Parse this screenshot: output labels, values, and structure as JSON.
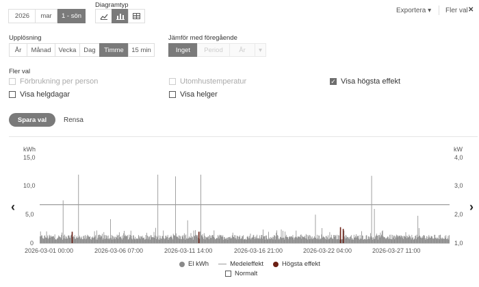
{
  "date": {
    "year": "2026",
    "month": "mar",
    "range": "1 - sön"
  },
  "chart_type": {
    "label": "Diagramtyp",
    "icons": [
      "line-chart-icon",
      "bar-chart-icon",
      "table-icon"
    ],
    "active": 1
  },
  "export_label": "Exportera ▾",
  "more_label": "Fler val",
  "close_glyph": "✕",
  "resolution": {
    "label": "Upplösning",
    "options": [
      "År",
      "Månad",
      "Vecka",
      "Dag",
      "Timme",
      "15 min"
    ],
    "active": 4
  },
  "compare": {
    "label": "Jämför med föregående",
    "options": [
      "Inget",
      "Period",
      "År",
      "▾"
    ],
    "active": 0
  },
  "more_options": {
    "label": "Fler val",
    "items": [
      {
        "label": "Förbrukning per person",
        "checked": false,
        "disabled": true
      },
      {
        "label": "Utomhustemperatur",
        "checked": false,
        "disabled": true
      },
      {
        "label": "Visa högsta effekt",
        "checked": true,
        "disabled": false
      },
      {
        "label": "Visa helgdagar",
        "checked": false,
        "disabled": false
      },
      {
        "label": "Visa helger",
        "checked": false,
        "disabled": false
      }
    ]
  },
  "save_label": "Spara val",
  "clear_label": "Rensa",
  "nav": {
    "prev": "‹",
    "next": "›"
  },
  "colors": {
    "bar": "#8a8a8a",
    "peak": "#6b1f14",
    "mean": "#9a9a9a",
    "active": "#7a7a7a"
  },
  "chart_data": {
    "type": "bar",
    "left_unit": "kWh",
    "right_unit": "kW",
    "left_ticks": [
      "15,0",
      "10,0",
      "5,0",
      "0"
    ],
    "right_ticks": [
      "4,0",
      "3,0",
      "2,0",
      "1,0"
    ],
    "ylim_left": [
      0,
      15
    ],
    "ylim_right": [
      1,
      4
    ],
    "x_ticks": [
      "2026-03-01 00:00",
      "2026-03-06 07:00",
      "2026-03-11 14:00",
      "2026-03-16 21:00",
      "2026-03-22 04:00",
      "2026-03-27 11:00"
    ],
    "hours": 744,
    "mean_effect_kw": 2.35,
    "spikes": [
      {
        "hour": 42,
        "kwh": 7.5
      },
      {
        "hour": 70,
        "kwh": 12.0
      },
      {
        "hour": 128,
        "kwh": 4.2
      },
      {
        "hour": 214,
        "kwh": 12.0
      },
      {
        "hour": 246,
        "kwh": 11.7
      },
      {
        "hour": 268,
        "kwh": 4.0
      },
      {
        "hour": 292,
        "kwh": 12.0
      },
      {
        "hour": 500,
        "kwh": 5.0
      },
      {
        "hour": 602,
        "kwh": 11.8
      },
      {
        "hour": 607,
        "kwh": 6.0
      },
      {
        "hour": 686,
        "kwh": 4.8
      }
    ],
    "peaks": [
      {
        "hour": 58,
        "kwh": 2.0
      },
      {
        "hour": 288,
        "kwh": 2.0
      },
      {
        "hour": 545,
        "kwh": 2.8
      },
      {
        "hour": 550,
        "kwh": 2.5
      }
    ],
    "legend": [
      {
        "label": "El kWh",
        "kind": "circle"
      },
      {
        "label": "Medeleffekt",
        "kind": "line"
      },
      {
        "label": "Högsta effekt",
        "kind": "circle-peak"
      },
      {
        "label": "Normalt",
        "kind": "checkbox"
      }
    ]
  }
}
